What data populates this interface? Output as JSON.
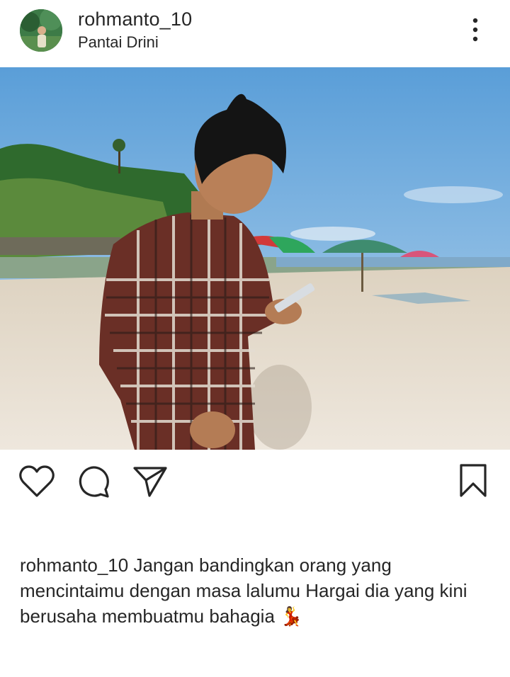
{
  "post": {
    "username": "rohmanto_10",
    "location": "Pantai Drini"
  },
  "icons": {
    "avatar": "avatar",
    "more": "more-vertical-icon",
    "like": "heart-icon",
    "comment": "comment-icon",
    "share": "send-icon",
    "save": "bookmark-icon"
  },
  "caption": {
    "username": "rohmanto_10",
    "text": "Jangan bandingkan orang yang mencintaimu dengan masa lalumu Hargai dia yang kini berusaha membuatmu bahagia",
    "emoji": "💃"
  },
  "colors": {
    "text": "#262626",
    "background": "#ffffff"
  }
}
